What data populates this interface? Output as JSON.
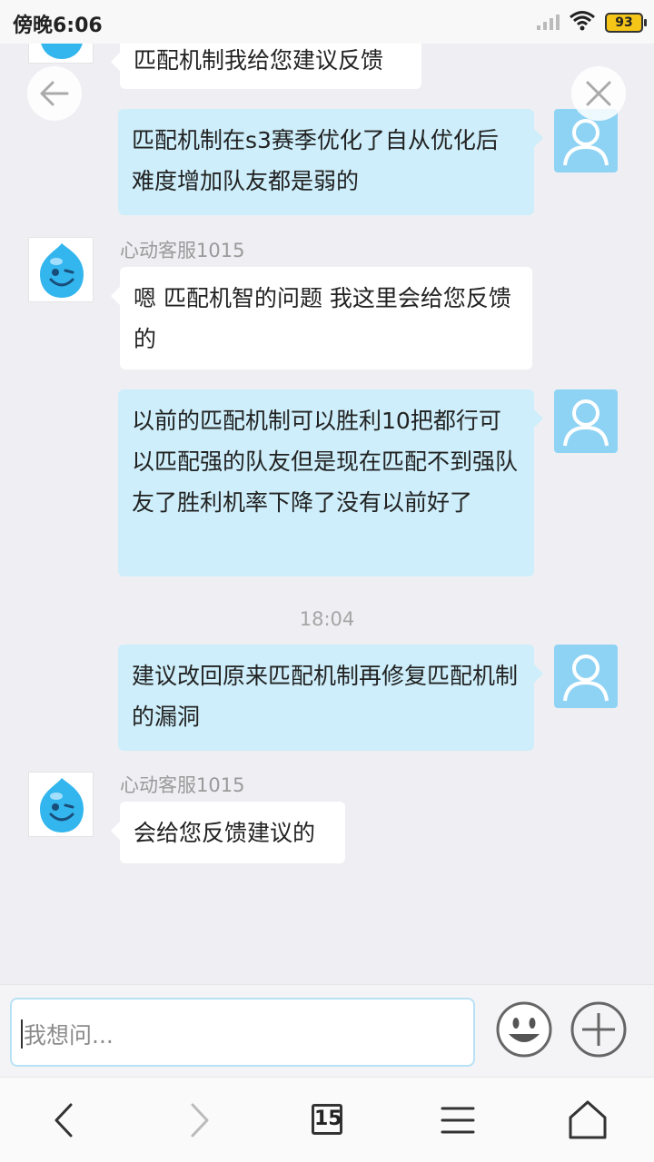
{
  "status_bar": {
    "time": "傍晚6:06",
    "battery": "93"
  },
  "chat": {
    "agent_name": "心动客服1015",
    "timestamp": "18:04",
    "messages": [
      {
        "side": "left",
        "text": "匹配机制我给您建议反馈"
      },
      {
        "side": "right",
        "text": "匹配机制在s3赛季优化了自从优化后难度增加队友都是弱的"
      },
      {
        "side": "left",
        "sender": "心动客服1015",
        "text": "嗯 匹配机智的问题 我这里会给您反馈的"
      },
      {
        "side": "right",
        "text": "以前的匹配机制可以胜利10把都行可以匹配强的队友但是现在匹配不到强队友了胜利机率下降了没有以前好了"
      },
      {
        "side": "right",
        "text": "建议改回原来匹配机制再修复匹配机制的漏洞"
      },
      {
        "side": "left",
        "sender": "心动客服1015",
        "text": "会给您反馈建议的"
      }
    ]
  },
  "input": {
    "placeholder": "我想问..."
  },
  "nav": {
    "tab_count": "15"
  },
  "icons": {
    "back": "arrow-left-icon",
    "close": "close-icon",
    "emoji": "smiley-icon",
    "plus": "plus-icon",
    "nav_back": "chevron-left-icon",
    "nav_forward": "chevron-right-icon",
    "tabs": "tabs-icon",
    "menu": "menu-icon",
    "home": "home-icon"
  },
  "colors": {
    "user_bubble": "#cdeefa",
    "agent_bubble": "#ffffff",
    "input_border": "#b9e1f5",
    "user_avatar": "#8fd3f4"
  }
}
